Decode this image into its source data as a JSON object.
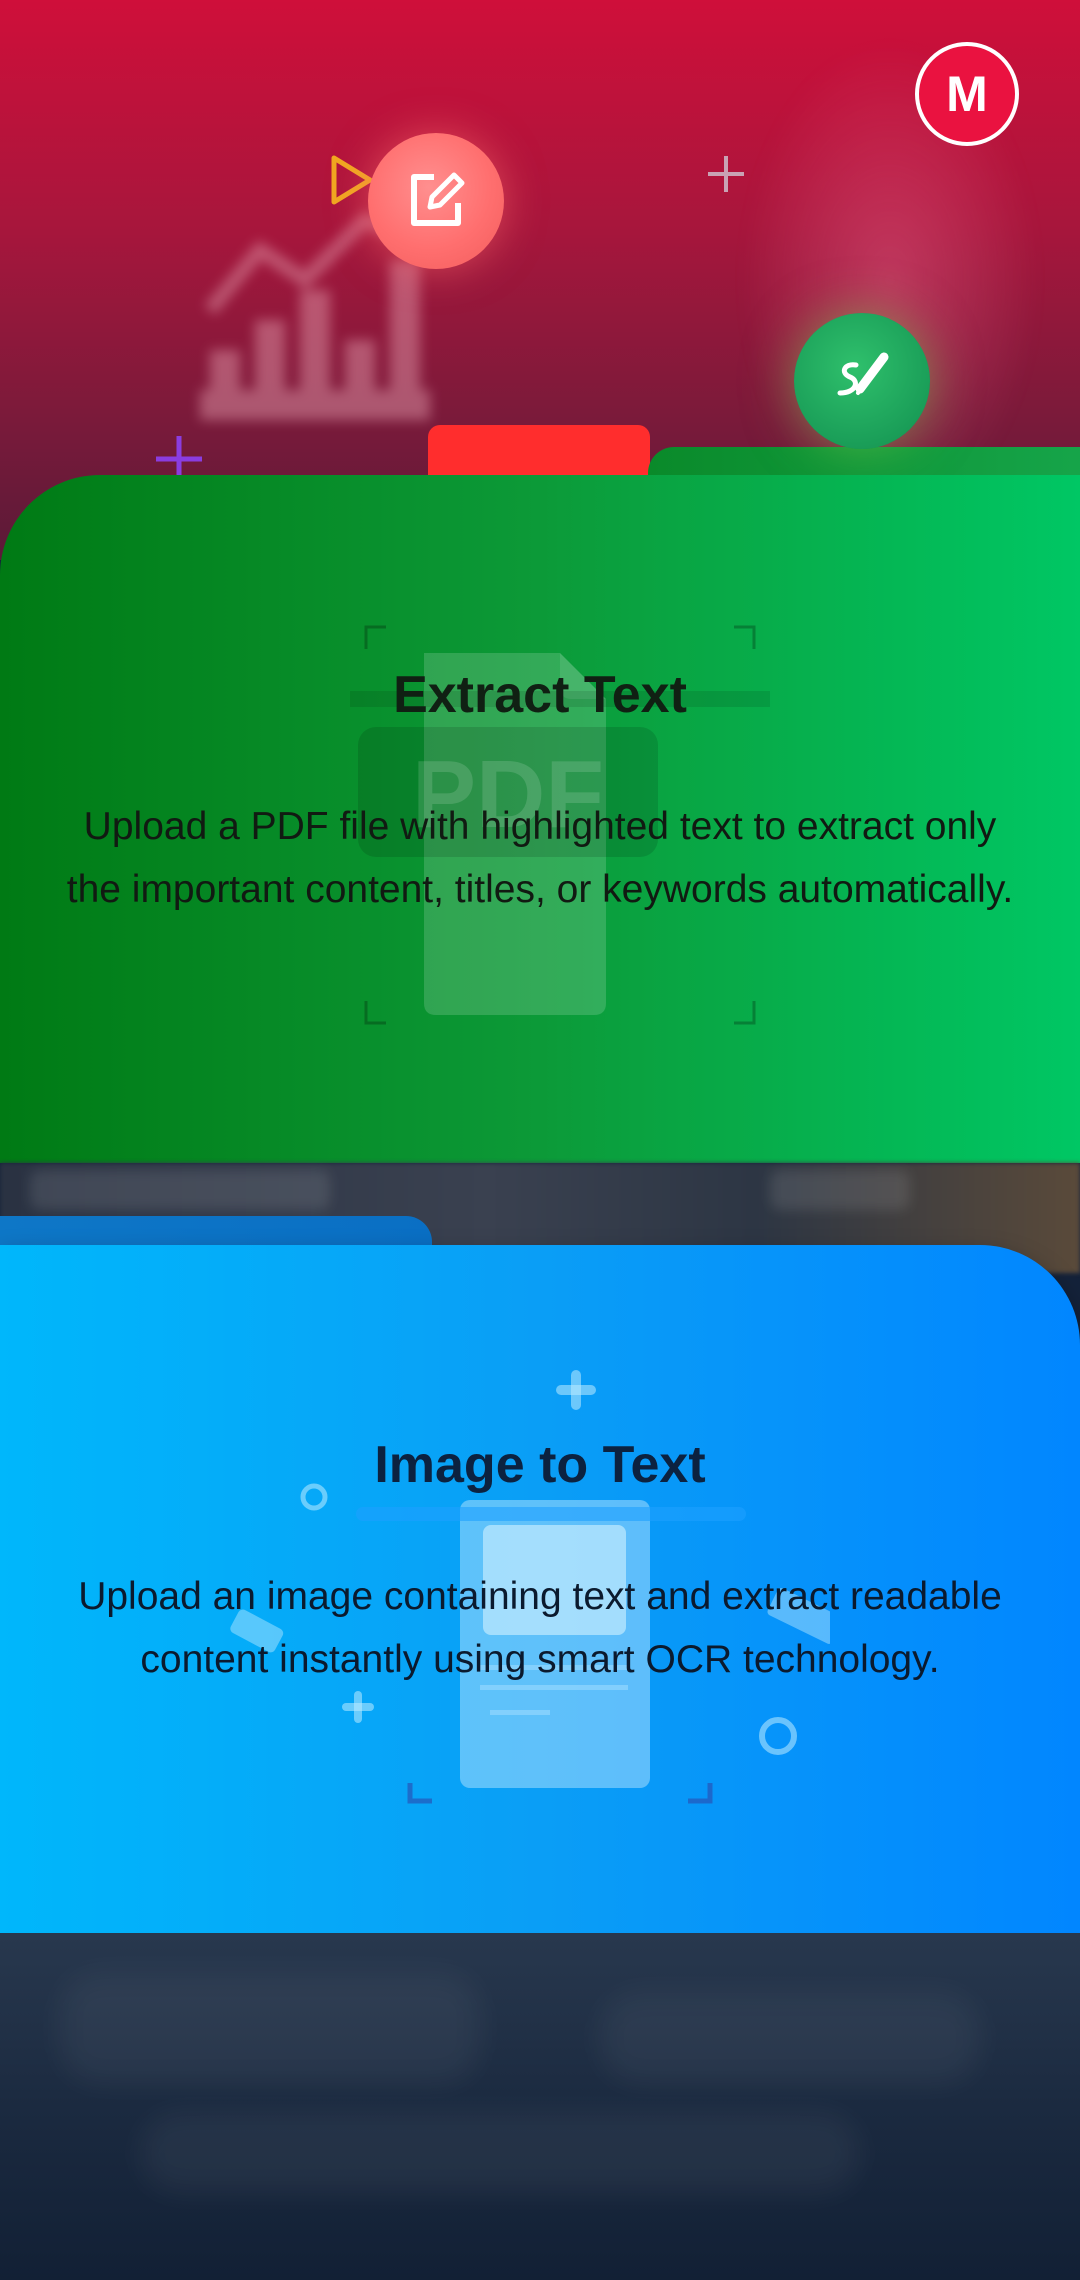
{
  "header": {
    "avatar_letter": "M"
  },
  "cards": [
    {
      "title": "Extract Text",
      "description": "Upload a PDF file with highlighted text to extract only the important content, titles, or keywords automatically.",
      "watermark": "PDF",
      "gradient": [
        "#007a14",
        "#00c764"
      ]
    },
    {
      "title": "Image to Text",
      "description": "Upload an image containing text and extract readable content instantly using smart OCR technology.",
      "gradient": [
        "#00b7fb",
        "#0186ff"
      ]
    }
  ],
  "icons": {
    "edit": "edit-icon",
    "signature": "signature-icon",
    "play": "play-icon",
    "plus": "plus-icon",
    "chart": "chart-icon",
    "pdf_document": "pdf-document-icon",
    "image_document": "image-document-icon"
  },
  "colors": {
    "hero_top": "#cf0f3a",
    "avatar": "#ea1240",
    "edit_fab": "#ff6f6f",
    "sign_fab": "#1a9e58"
  }
}
